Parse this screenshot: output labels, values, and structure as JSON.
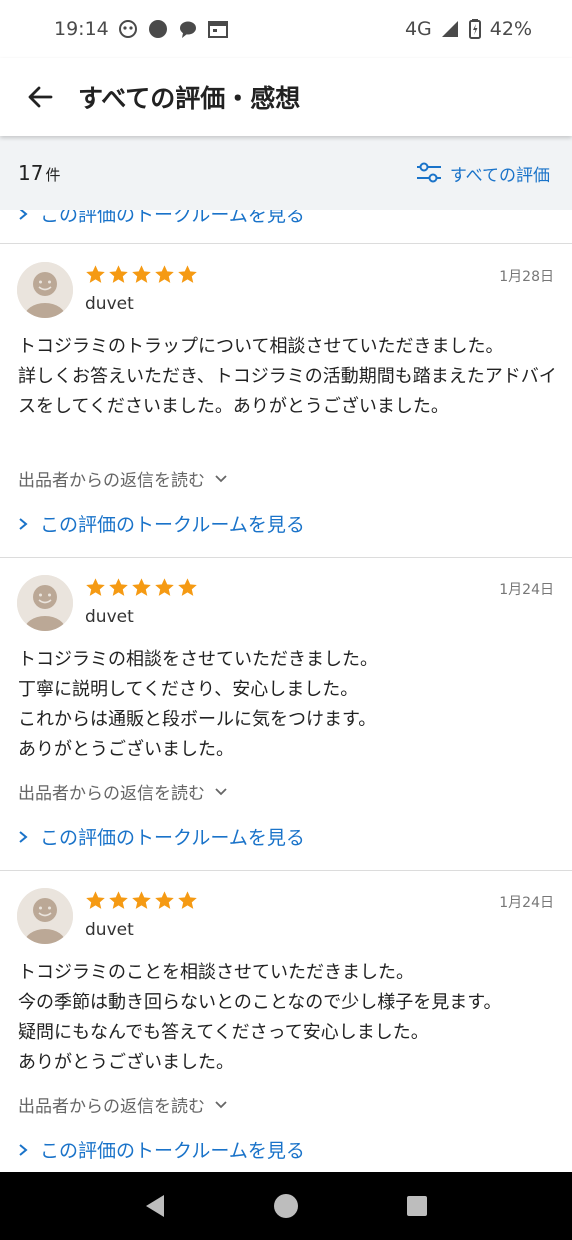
{
  "status_bar": {
    "time": "19:14",
    "network": "4G",
    "battery": "42%"
  },
  "app_bar": {
    "title": "すべての評価・感想"
  },
  "summary": {
    "count": "17",
    "count_unit": "件",
    "filter_label": "すべての評価"
  },
  "top_partial_link": "この評価のトークルームを見る",
  "reviews": [
    {
      "rating": 5,
      "user": "duvet",
      "date": "1月28日",
      "text": "トコジラミのトラップについて相談させていただきました。\n詳しくお答えいただき、トコジラミの活動期間も踏まえたアドバイスをしてくださいました。ありがとうございました。",
      "reply_label": "出品者からの返信を読む",
      "link_label": "この評価のトークルームを見る"
    },
    {
      "rating": 5,
      "user": "duvet",
      "date": "1月24日",
      "text": "トコジラミの相談をさせていただきました。\n丁寧に説明してくださり、安心しました。\nこれからは通販と段ボールに気をつけます。\nありがとうございました。",
      "reply_label": "出品者からの返信を読む",
      "link_label": "この評価のトークルームを見る"
    },
    {
      "rating": 5,
      "user": "duvet",
      "date": "1月24日",
      "text": "トコジラミのことを相談させていただきました。\n今の季節は動き回らないとのことなので少し様子を見ます。\n疑問にもなんでも答えてくださって安心しました。\nありがとうございました。",
      "reply_label": "出品者からの返信を読む",
      "link_label": "この評価のトークルームを見る"
    }
  ],
  "colors": {
    "star": "#f59a13",
    "link": "#1a73c9",
    "subheader_bg": "#f1f3f5"
  }
}
